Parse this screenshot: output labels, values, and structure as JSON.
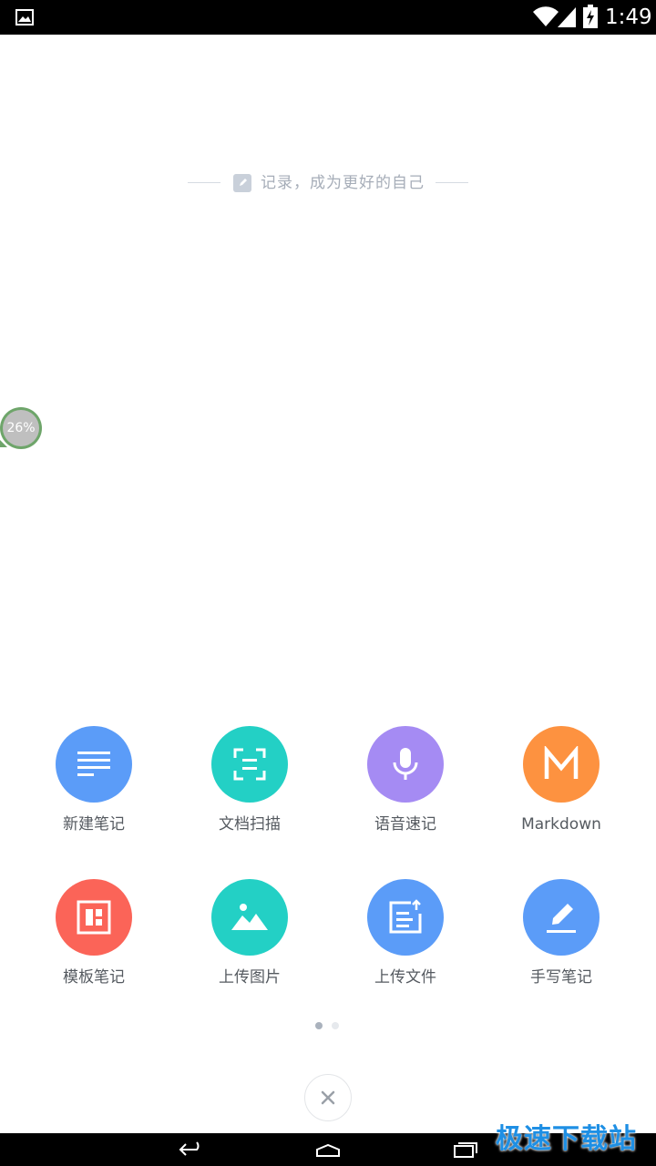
{
  "status_bar": {
    "time": "1:49"
  },
  "slogan": {
    "text": "记录，成为更好的自己"
  },
  "float_badge": {
    "percent": "26%"
  },
  "actions": [
    {
      "label": "新建笔记",
      "color": "#5b9cf8",
      "icon": "lines-icon"
    },
    {
      "label": "文档扫描",
      "color": "#23d0c5",
      "icon": "scan-icon"
    },
    {
      "label": "语音速记",
      "color": "#a58bf3",
      "icon": "microphone-icon"
    },
    {
      "label": "Markdown",
      "color": "#fd9240",
      "icon": "markdown-icon"
    },
    {
      "label": "模板笔记",
      "color": "#fb6458",
      "icon": "template-icon"
    },
    {
      "label": "上传图片",
      "color": "#23d0c5",
      "icon": "image-icon"
    },
    {
      "label": "上传文件",
      "color": "#5b9cf8",
      "icon": "file-upload-icon"
    },
    {
      "label": "手写笔记",
      "color": "#5b9cf8",
      "icon": "pen-icon"
    }
  ],
  "pager": {
    "current": 1,
    "total": 2
  },
  "watermark": "极速下载站"
}
